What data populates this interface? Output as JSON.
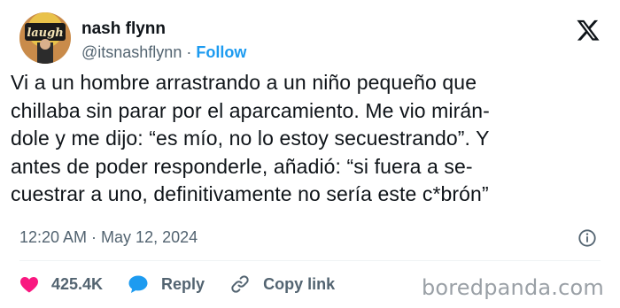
{
  "author": {
    "name": "nash flynn",
    "handle": "@itsnashflynn",
    "separator": "·",
    "follow_label": "Follow",
    "avatar_icon": "laugh-factory-avatar",
    "avatar_text": "laugh"
  },
  "tweet": {
    "lines": [
      "Vi a un hombre arrastrando a un niño pequeño que",
      "chillaba sin parar por el aparcamiento. Me vio mirán-",
      "dole y me dijo: “es mío, no lo estoy secuestrando”. Y",
      "antes de poder responderle, añadió: “si fuera a se-",
      "cuestrar a uno, definitivamente no sería este c*brón”"
    ],
    "time": "12:20 AM · May 12, 2024"
  },
  "actions": {
    "like_count": "425.4K",
    "reply_label": "Reply",
    "copy_label": "Copy link"
  },
  "watermark": "boredpanda.com",
  "colors": {
    "heart": "#f91880",
    "reply": "#1d9bf0",
    "follow": "#1d9bf0",
    "muted": "#536471"
  }
}
